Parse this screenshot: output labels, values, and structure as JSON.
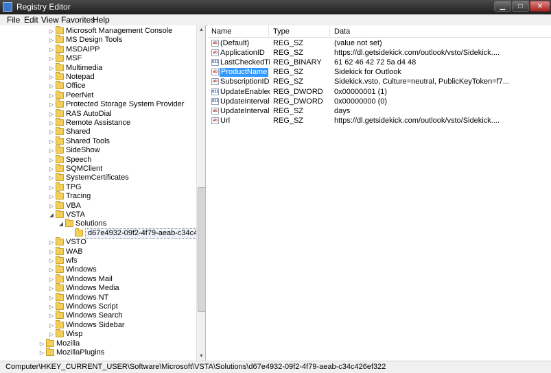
{
  "window": {
    "title": "Registry Editor"
  },
  "menu": [
    "File",
    "Edit",
    "View",
    "Favorites",
    "Help"
  ],
  "tree": [
    {
      "label": "Microsoft Management Console",
      "indent": 0,
      "arrow": "▷"
    },
    {
      "label": "MS Design Tools",
      "indent": 0,
      "arrow": "▷"
    },
    {
      "label": "MSDAIPP",
      "indent": 0,
      "arrow": "▷"
    },
    {
      "label": "MSF",
      "indent": 0,
      "arrow": "▷"
    },
    {
      "label": "Multimedia",
      "indent": 0,
      "arrow": "▷"
    },
    {
      "label": "Notepad",
      "indent": 0,
      "arrow": "▷"
    },
    {
      "label": "Office",
      "indent": 0,
      "arrow": "▷"
    },
    {
      "label": "PeerNet",
      "indent": 0,
      "arrow": "▷"
    },
    {
      "label": "Protected Storage System Provider",
      "indent": 0,
      "arrow": "▷"
    },
    {
      "label": "RAS AutoDial",
      "indent": 0,
      "arrow": "▷"
    },
    {
      "label": "Remote Assistance",
      "indent": 0,
      "arrow": "▷"
    },
    {
      "label": "Shared",
      "indent": 0,
      "arrow": "▷"
    },
    {
      "label": "Shared Tools",
      "indent": 0,
      "arrow": "▷"
    },
    {
      "label": "SideShow",
      "indent": 0,
      "arrow": "▷"
    },
    {
      "label": "Speech",
      "indent": 0,
      "arrow": "▷"
    },
    {
      "label": "SQMClient",
      "indent": 0,
      "arrow": "▷"
    },
    {
      "label": "SystemCertificates",
      "indent": 0,
      "arrow": "▷"
    },
    {
      "label": "TPG",
      "indent": 0,
      "arrow": "▷"
    },
    {
      "label": "Tracing",
      "indent": 0,
      "arrow": "▷"
    },
    {
      "label": "VBA",
      "indent": 0,
      "arrow": "▷"
    },
    {
      "label": "VSTA",
      "indent": 0,
      "arrow": "◢"
    },
    {
      "label": "Solutions",
      "indent": 1,
      "arrow": "◢"
    },
    {
      "label": "d67e4932-09f2-4f79-aeab-c34c426ef322",
      "indent": 2,
      "arrow": "",
      "selected": true
    },
    {
      "label": "VSTO",
      "indent": 0,
      "arrow": "▷"
    },
    {
      "label": "WAB",
      "indent": 0,
      "arrow": "▷"
    },
    {
      "label": "wfs",
      "indent": 0,
      "arrow": "▷"
    },
    {
      "label": "Windows",
      "indent": 0,
      "arrow": "▷"
    },
    {
      "label": "Windows Mail",
      "indent": 0,
      "arrow": "▷"
    },
    {
      "label": "Windows Media",
      "indent": 0,
      "arrow": "▷"
    },
    {
      "label": "Windows NT",
      "indent": 0,
      "arrow": "▷"
    },
    {
      "label": "Windows Script",
      "indent": 0,
      "arrow": "▷"
    },
    {
      "label": "Windows Search",
      "indent": 0,
      "arrow": "▷"
    },
    {
      "label": "Windows Sidebar",
      "indent": 0,
      "arrow": "▷"
    },
    {
      "label": "Wisp",
      "indent": 0,
      "arrow": "▷"
    },
    {
      "label": "Mozilla",
      "indent": -1,
      "arrow": "▷"
    },
    {
      "label": "MozillaPlugins",
      "indent": -1,
      "arrow": "▷"
    }
  ],
  "columns": {
    "name": "Name",
    "type": "Type",
    "data": "Data"
  },
  "values": [
    {
      "icon": "ab",
      "name": "(Default)",
      "type": "REG_SZ",
      "data": "(value not set)"
    },
    {
      "icon": "ab",
      "name": "ApplicationID",
      "type": "REG_SZ",
      "data": "https://dl.getsidekick.com/outlook/vsto/Sidekick...."
    },
    {
      "icon": "bin",
      "name": "LastCheckedTime",
      "type": "REG_BINARY",
      "data": "61 62 46 42 72 5a d4 48"
    },
    {
      "icon": "ab",
      "name": "ProductName",
      "type": "REG_SZ",
      "data": "Sidekick for Outlook",
      "selected": true
    },
    {
      "icon": "ab",
      "name": "SubscriptionID",
      "type": "REG_SZ",
      "data": "Sidekick.vsto, Culture=neutral, PublicKeyToken=f7..."
    },
    {
      "icon": "bin",
      "name": "UpdateEnabled",
      "type": "REG_DWORD",
      "data": "0x00000001 (1)"
    },
    {
      "icon": "bin",
      "name": "UpdateInterval",
      "type": "REG_DWORD",
      "data": "0x00000000 (0)"
    },
    {
      "icon": "ab",
      "name": "UpdateIntervalU...",
      "type": "REG_SZ",
      "data": "days"
    },
    {
      "icon": "ab",
      "name": "Url",
      "type": "REG_SZ",
      "data": "https://dl.getsidekick.com/outlook/vsto/Sidekick...."
    }
  ],
  "status": {
    "path": "Computer\\HKEY_CURRENT_USER\\Software\\Microsoft\\VSTA\\Solutions\\d67e4932-09f2-4f79-aeab-c34c426ef322"
  }
}
